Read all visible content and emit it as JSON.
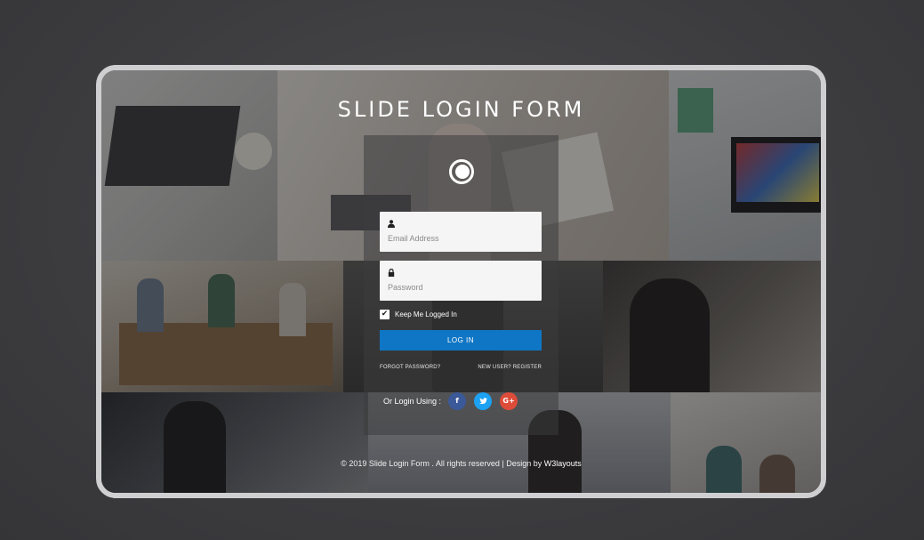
{
  "header": {
    "title": "SLIDE LOGIN FORM"
  },
  "form": {
    "logo_icon": "circle-logo-icon",
    "email": {
      "icon": "user-icon",
      "placeholder": "Email Address",
      "value": ""
    },
    "password": {
      "icon": "lock-icon",
      "placeholder": "Password",
      "value": ""
    },
    "remember": {
      "label": "Keep Me Logged In",
      "checked": true
    },
    "login_label": "LOG IN",
    "forgot_label": "FORGOT PASSWORD?",
    "register_label": "NEW USER? REGISTER",
    "social": {
      "label": "Or Login Using :",
      "facebook": "f",
      "twitter": "✓",
      "google": "G+"
    }
  },
  "footer": {
    "text": "© 2019 Slide Login Form . All rights reserved | Design by ",
    "link": "W3layouts"
  },
  "colors": {
    "accent": "#0f76c5",
    "facebook": "#3b5998",
    "twitter": "#1da1f2",
    "google": "#dd4b39"
  }
}
